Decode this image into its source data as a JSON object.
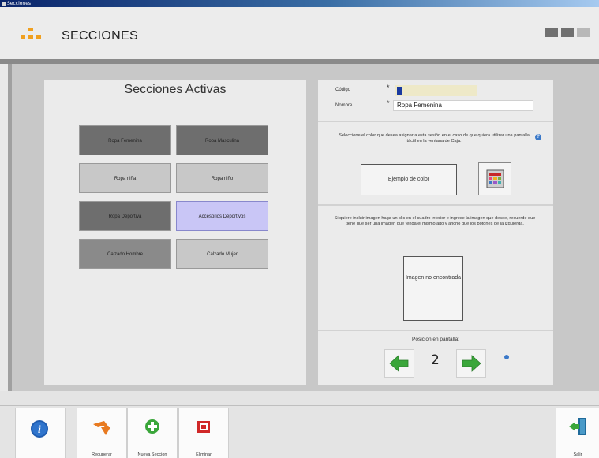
{
  "window": {
    "title": "Secciones"
  },
  "header": {
    "title": "SECCIONES"
  },
  "left": {
    "title": "Secciones Activas",
    "sections": [
      {
        "label": "Ropa Femenina"
      },
      {
        "label": "Ropa Masculina"
      },
      {
        "label": "Ropa niña"
      },
      {
        "label": "Ropa niño"
      },
      {
        "label": "Ropa Deportiva"
      },
      {
        "label": "Accesorios Deportivos"
      },
      {
        "label": "Calzado Hombre"
      },
      {
        "label": "Calzado Mujer"
      }
    ]
  },
  "form": {
    "codigo_label": "Código",
    "codigo_value": "",
    "nombre_label": "Nombre",
    "nombre_value": "Ropa Femenina",
    "required_mark": "*"
  },
  "color": {
    "info": "Seleccione el color que desea asignar a esta sesión en el caso de que quiera utilizar una pantalla táctil en la ventana de Caja.",
    "example_label": "Ejemplo de color"
  },
  "image": {
    "info": "Si quiere incluir imagen haga un clic en el cuadro inferior e ingrese la imagen que desee, recuerde que tiene que ser una imagen que tenga el mismo alto y ancho que los botones de la izquierda.",
    "placeholder": "Imagen no encontrada"
  },
  "position": {
    "label": "Posicion en pantalla:",
    "value": "2"
  },
  "toolbar": {
    "recuperar": "Recuperar",
    "nueva": "Nueva Seccion",
    "eliminar": "Eliminar",
    "salir": "Salir"
  },
  "colors": {
    "section_dark": "#6e6e6e",
    "section_light": "#c8c8c8",
    "section_selected": "#c9c6f6",
    "codigo_bg": "#eee9c8",
    "arrow_green": "#3aa63a",
    "help_blue": "#3a78c8"
  }
}
